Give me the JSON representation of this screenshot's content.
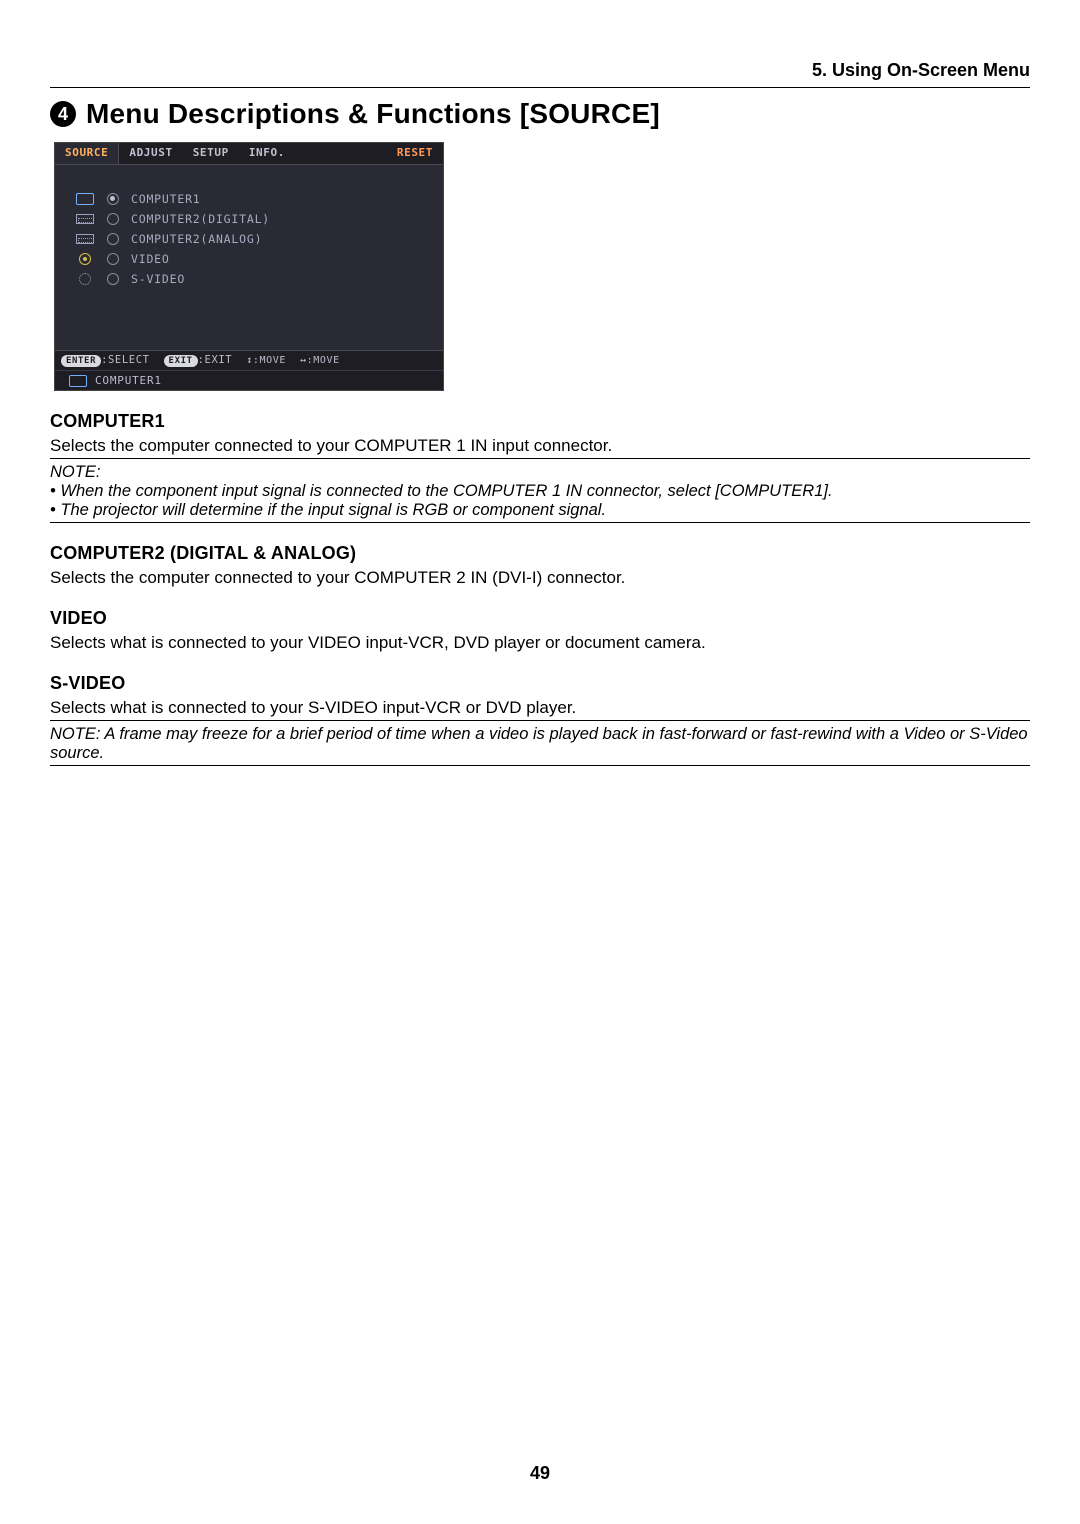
{
  "page": {
    "chapter": "5. Using On-Screen Menu",
    "section_number": "4",
    "title": "Menu Descriptions & Functions [SOURCE]",
    "page_number": "49"
  },
  "osd": {
    "tabs": {
      "source": "SOURCE",
      "adjust": "ADJUST",
      "setup": "SETUP",
      "info": "INFO.",
      "reset": "RESET"
    },
    "items": [
      {
        "label": "COMPUTER1",
        "selected": true
      },
      {
        "label": "COMPUTER2(DIGITAL)",
        "selected": false
      },
      {
        "label": "COMPUTER2(ANALOG)",
        "selected": false
      },
      {
        "label": "VIDEO",
        "selected": false
      },
      {
        "label": "S-VIDEO",
        "selected": false
      }
    ],
    "hints": {
      "enter_pill": "ENTER",
      "enter_label": ":SELECT",
      "exit_pill": "EXIT",
      "exit_label": ":EXIT",
      "updown": "↕:MOVE",
      "leftright": "↔:MOVE"
    },
    "status": "COMPUTER1"
  },
  "sections": {
    "computer1": {
      "heading": "COMPUTER1",
      "body": "Selects the computer connected to your COMPUTER 1 IN input connector.",
      "note_head": "NOTE:",
      "note1": "When the component input signal is connected to the COMPUTER 1 IN connector, select [COMPUTER1].",
      "note2": "The projector will determine if the input signal is RGB or component signal."
    },
    "computer2": {
      "heading": "COMPUTER2 (DIGITAL & ANALOG)",
      "body": "Selects the computer connected to your COMPUTER 2 IN (DVI-I) connector."
    },
    "video": {
      "heading": "VIDEO",
      "body": "Selects what is connected to your VIDEO input-VCR, DVD player or document camera."
    },
    "svideo": {
      "heading": "S-VIDEO",
      "body": "Selects what is connected to your S-VIDEO input-VCR or DVD player.",
      "note": "NOTE: A frame may freeze for a brief period of time when a video is played back in fast-forward or fast-rewind with a Video or S-Video source."
    }
  }
}
